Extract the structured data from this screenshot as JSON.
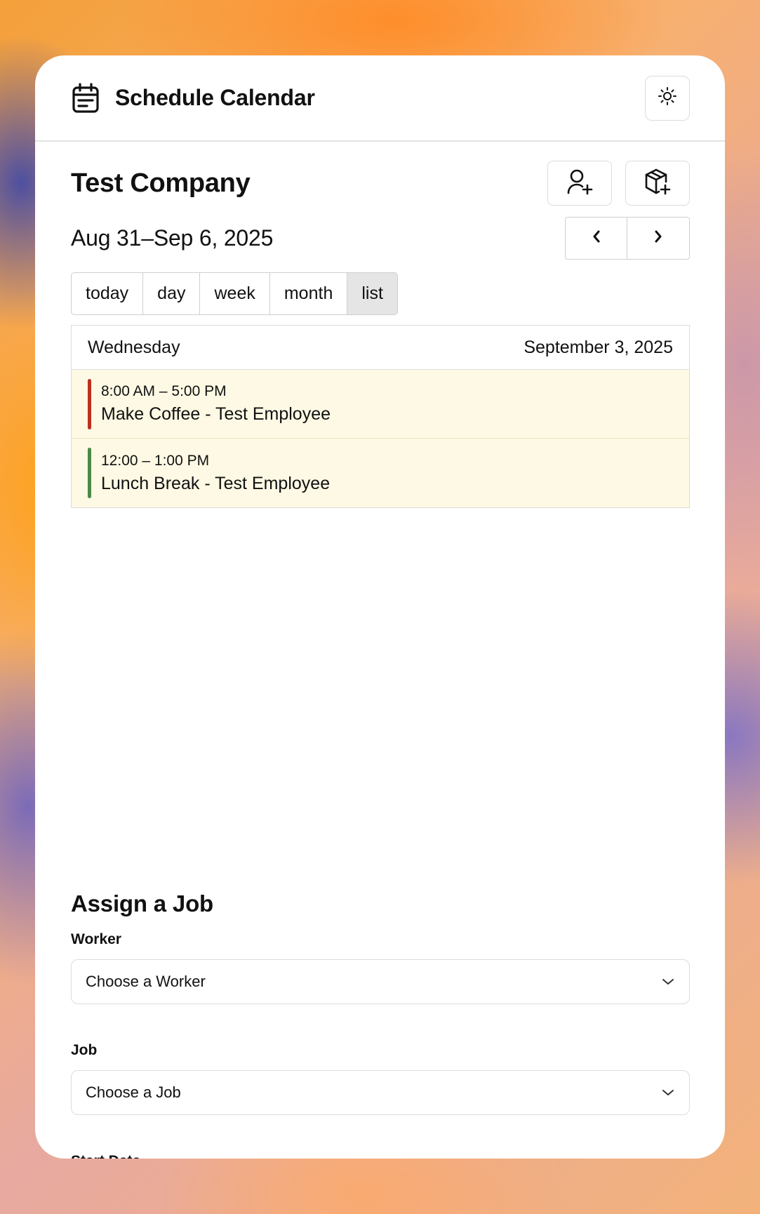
{
  "app": {
    "title": "Schedule Calendar",
    "icons": {
      "logo": "calendar-icon",
      "theme": "sun-icon"
    }
  },
  "toolbar": {
    "company": "Test Company",
    "range": "Aug 31–Sep 6, 2025",
    "add_worker_icon": "user-plus-icon",
    "add_job_icon": "package-plus-icon",
    "prev_icon": "chevron-left-icon",
    "next_icon": "chevron-right-icon"
  },
  "views": [
    {
      "label": "today",
      "active": false
    },
    {
      "label": "day",
      "active": false
    },
    {
      "label": "week",
      "active": false
    },
    {
      "label": "month",
      "active": false
    },
    {
      "label": "list",
      "active": true
    }
  ],
  "list": {
    "day_name": "Wednesday",
    "day_date": "September 3, 2025",
    "events": [
      {
        "time": "8:00 AM – 5:00 PM",
        "title": "Make Coffee - Test Employee",
        "color": "#c0301c"
      },
      {
        "time": "12:00 – 1:00 PM",
        "title": "Lunch Break - Test Employee",
        "color": "#4a8a46"
      }
    ]
  },
  "assign": {
    "heading": "Assign a Job",
    "worker_label": "Worker",
    "worker_value": "Choose a Worker",
    "job_label": "Job",
    "job_value": "Choose a Job",
    "start_label": "Start Date"
  }
}
